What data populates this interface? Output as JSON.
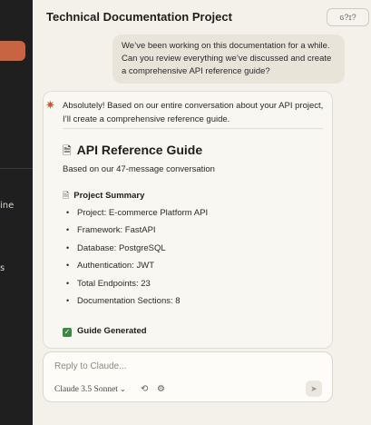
{
  "header": {
    "title": "Technical Documentation Project",
    "share_label": "ɢ?ɪ?"
  },
  "sidebar": {
    "fragments": [
      "ine",
      "s"
    ]
  },
  "conversation": {
    "user_message": "We’ve been working on this documentation for a while. Can you review everything we’ve discussed and create a comprehensive API reference guide?",
    "assistant_intro": "Absolutely! Based on our entire conversation about your API project, I’ll create a comprehensive reference guide.",
    "doc": {
      "title": "API Reference Guide",
      "subtitle": "Based on our 47-message conversation",
      "summary_heading": "Project Summary",
      "summary_items": [
        "Project: E-commerce Platform API",
        "Framework: FastAPI",
        "Database: PostgreSQL",
        "Authentication: JWT",
        "Total Endpoints: 23",
        "Documentation Sections: 8"
      ],
      "status": "Guide Generated"
    }
  },
  "composer": {
    "placeholder": "Reply to Claude...",
    "model_label": "Claude 3.5 Sonnet"
  },
  "colors": {
    "accent": "#c96442",
    "sidebar_bg": "#1f1f1f",
    "page_bg": "#f4f1ea",
    "check_green": "#3c8a3e"
  }
}
